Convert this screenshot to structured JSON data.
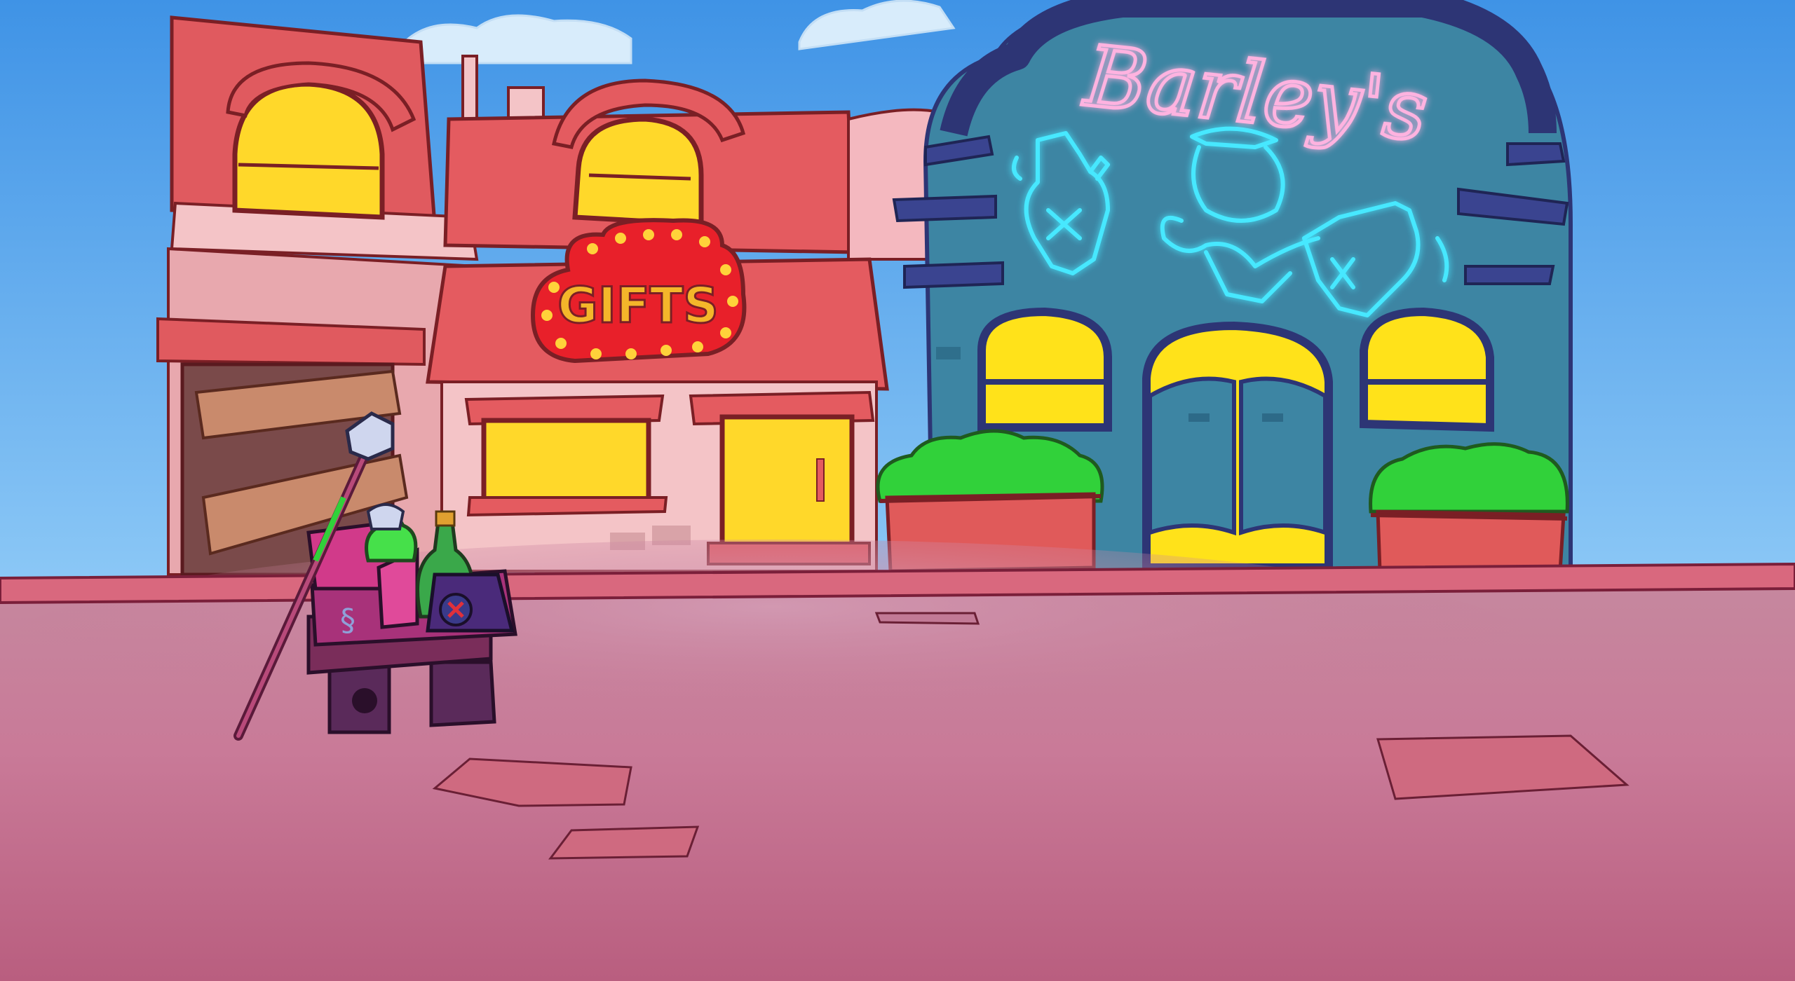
{
  "scene": {
    "type": "cartoon-town-street-background",
    "sky_color_top": "#3f93e6",
    "sky_color_bottom": "#8cc8f6",
    "ground_color": "#c9718f",
    "sidewalk_color": "#d9687e"
  },
  "gift_shop": {
    "sign_text": "GIFTS",
    "sign_color": "#e8202a",
    "sign_text_color": "#f4b62a",
    "bulb_color": "#ffd23a",
    "roof_color": "#e45b60",
    "wall_color": "#f4c4c7"
  },
  "barleys": {
    "neon_text": "Barley's",
    "neon_text_color": "#ffb3e0",
    "neon_art_color": "#46e8ff",
    "neon_art_icon": "bartender-with-bottles-icon",
    "building_color": "#3d85a3",
    "trim_color": "#2d3575",
    "window_color": "#ffe21a"
  },
  "boarded_building": {
    "roof_color": "#e05a5f",
    "plank_color": "#c98a6c"
  },
  "market_stall": {
    "icons": [
      "staff-icon",
      "potion-bottle-icon",
      "green-bottle-icon",
      "crate-icon"
    ],
    "cloth_color": "#e04a9a",
    "stall_color": "#7a2d5a"
  },
  "planters": {
    "bush_color": "#31d13a",
    "pot_color": "#e05a5a"
  }
}
